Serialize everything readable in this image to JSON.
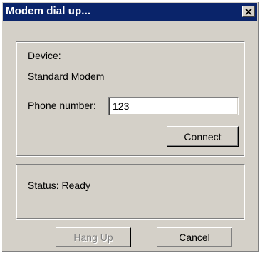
{
  "window": {
    "title": "Modem dial up...",
    "close_glyph": "✕"
  },
  "device": {
    "label": "Device:",
    "value": "Standard Modem"
  },
  "phone": {
    "label": "Phone number:",
    "value": "123"
  },
  "buttons": {
    "connect": "Connect",
    "hang_up": "Hang Up",
    "hang_up_enabled": false,
    "cancel": "Cancel"
  },
  "status": {
    "text": "Status: Ready"
  },
  "colors": {
    "titlebar": "#0a246a",
    "face": "#d4d0c8",
    "disabled_text": "#808080"
  },
  "icons": {
    "close": "close-icon"
  }
}
